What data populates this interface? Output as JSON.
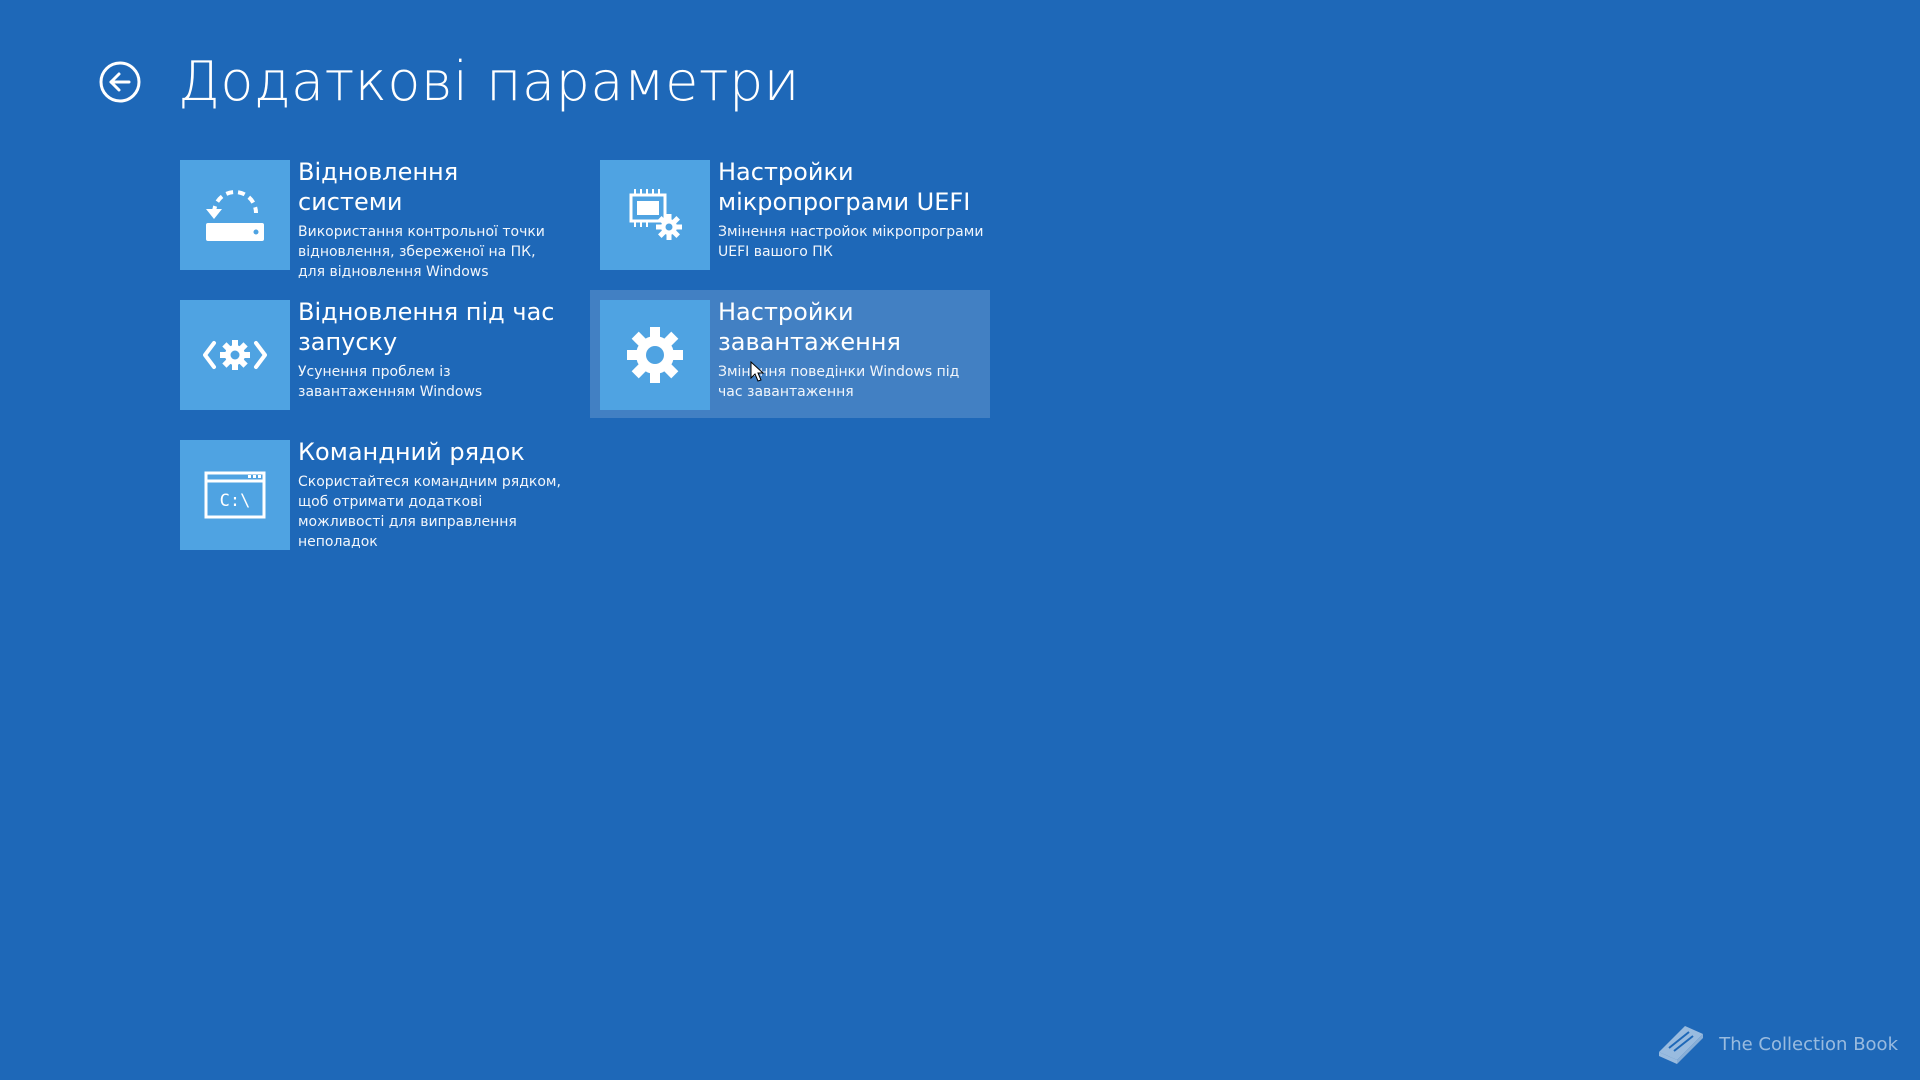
{
  "page": {
    "title": "Додаткові параметри",
    "back_icon": "back-arrow-circle-icon"
  },
  "colors": {
    "background": "#1e68b8",
    "tile": "#4fa3e2",
    "text": "#ffffff"
  },
  "options": [
    {
      "id": "system-restore",
      "icon": "system-restore-icon",
      "name": "Відновлення системи",
      "desc": "Використання контрольної точки відновлення, збереженої на ПК, для відновлення Windows"
    },
    {
      "id": "uefi-firmware",
      "icon": "uefi-firmware-icon",
      "name": "Настройки мікропрограми UEFI",
      "desc": "Змінення настройок мікропрограми UEFI вашого ПК"
    },
    {
      "id": "startup-repair",
      "icon": "startup-repair-icon",
      "name": "Відновлення під час запуску",
      "desc": "Усунення проблем із завантаженням Windows"
    },
    {
      "id": "startup-settings",
      "icon": "gear-icon",
      "name": "Настройки завантаження",
      "desc": "Змінення поведінки Windows під час завантаження",
      "hovered": true
    },
    {
      "id": "command-prompt",
      "icon": "command-prompt-icon",
      "name": "Командний рядок",
      "desc": "Скористайтеся командним рядком, щоб отримати додаткові можливості для виправлення неполадок",
      "icon_text": "C:\\"
    }
  ],
  "watermark": {
    "icon": "book-icon",
    "text": "The Collection Book"
  }
}
